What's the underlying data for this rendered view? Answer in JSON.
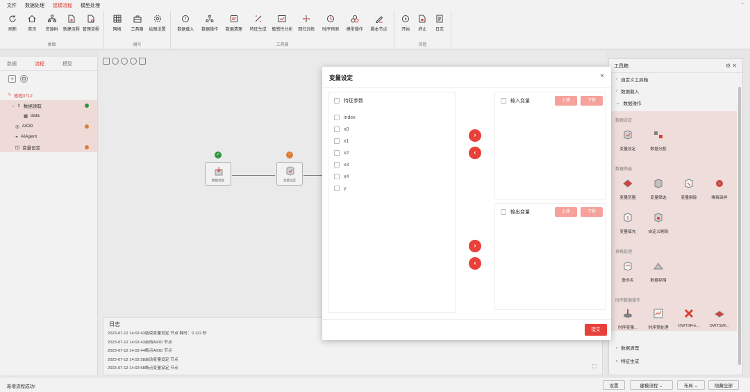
{
  "menubar": {
    "items": [
      "文件",
      "数据处理",
      "建模流程",
      "模型处理"
    ],
    "active_index": 2
  },
  "ribbon": {
    "groups": [
      {
        "name": "桌面",
        "buttons": [
          "刷新",
          "首页",
          "资源树",
          "新建流程",
          "管理流程"
        ]
      },
      {
        "name": "编号",
        "buttons": [
          "网格",
          "工具箱",
          "绘图设置"
        ]
      },
      {
        "name": "工具箱",
        "buttons": [
          "数据载入",
          "数据操作",
          "数据清理",
          "特征生成",
          "敏感性分析",
          "回归训练",
          "时序预测",
          "模型操作",
          "脚本节点"
        ]
      },
      {
        "name": "流程",
        "buttons": [
          "开始",
          "终止",
          "日志"
        ]
      }
    ]
  },
  "left_panel": {
    "tabs": [
      "数据",
      "流程",
      "模型"
    ],
    "active_tab": 1,
    "flow_name": "流程0712",
    "tree": [
      {
        "label": "数据读取",
        "status": "#2ea043"
      },
      {
        "label": "data",
        "status": ""
      },
      {
        "label": "AIOD",
        "status": "#e8833a"
      },
      {
        "label": "AIAgent",
        "status": ""
      },
      {
        "label": "变量设定",
        "status": "#e8833a"
      }
    ]
  },
  "canvas": {
    "nodes": [
      {
        "label": "数据读取",
        "badge": "✓",
        "badge_color": "#2ea043"
      },
      {
        "label": "变量设定",
        "badge": "−",
        "badge_color": "#e8833a"
      }
    ]
  },
  "log": {
    "title": "日志",
    "lines": [
      "2023-07-12 14:02:43结束变量设定 节点 耗时：0.122 秒",
      "2023-07-12 14:02:43启动AIOD 节点",
      "2023-07-12 14:02:44断点AIOD 节点",
      "2023-07-12 14:02:58启动变量设定 节点",
      "2023-07-12 14:02:58断点变量设定 节点"
    ]
  },
  "toolbox": {
    "title": "工具箱",
    "top_rows": [
      "自定义工具箱",
      "数据载入",
      "数据操作"
    ],
    "sections": [
      {
        "name": "数据设定",
        "tools": [
          "变量设定",
          "数据分割"
        ]
      },
      {
        "name": "数据筛选",
        "tools": [
          "变量范围",
          "变量筛选",
          "变量剔除",
          "稀释采样"
        ]
      },
      {
        "name": "",
        "tools": [
          "变量填充",
          "自定义剔除"
        ]
      },
      {
        "name": "表格处理",
        "tools": [
          "重命名",
          "数据存储"
        ]
      },
      {
        "name": "时序数据操作",
        "tools": [
          "时序变量...",
          "时序预处理",
          "DWTSFre...",
          "DWTSWi..."
        ]
      }
    ],
    "bottom_rows": [
      "数据清理",
      "特征生成"
    ]
  },
  "statusbar": {
    "message": "新增流程成功!",
    "buttons": [
      "设置",
      "建模流程 ⌄",
      "布局 ⌄",
      "隐藏全部"
    ]
  },
  "modal": {
    "title": "变量设定",
    "close": "×",
    "feature_header": "特征参数",
    "features": [
      "index",
      "x0",
      "x1",
      "x2",
      "x3",
      "x4",
      "y"
    ],
    "input_title": "输入变量",
    "output_title": "输出变量",
    "up_label": "上移",
    "down_label": "下移",
    "submit_label": "提交"
  },
  "colors": {
    "accent": "#e8413a",
    "accent_light": "#f6a19b",
    "success": "#2ea043",
    "warning": "#e8833a"
  }
}
